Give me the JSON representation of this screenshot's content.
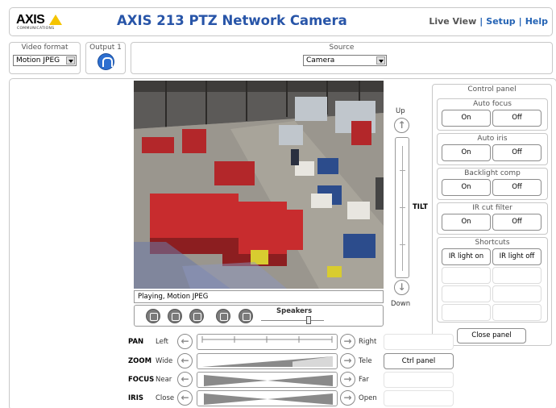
{
  "header": {
    "logo_text": "AXIS",
    "logo_subtext": "COMMUNICATIONS",
    "title": "AXIS 213 PTZ Network Camera",
    "nav": {
      "live_view": "Live View",
      "setup": "Setup",
      "help": "Help",
      "separator": "|"
    }
  },
  "toolbar": {
    "video_format": {
      "label": "Video format",
      "value": "Motion JPEG"
    },
    "output": {
      "label": "Output 1"
    },
    "source": {
      "label": "Source",
      "value": "Camera"
    }
  },
  "player": {
    "status": "Playing, Motion JPEG",
    "speakers_label": "Speakers",
    "volume": 0.75
  },
  "tilt": {
    "up_label": "Up",
    "down_label": "Down",
    "label": "TILT"
  },
  "control_panel": {
    "title": "Control panel",
    "auto_focus": {
      "title": "Auto focus",
      "on": "On",
      "off": "Off"
    },
    "auto_iris": {
      "title": "Auto iris",
      "on": "On",
      "off": "Off"
    },
    "backlight": {
      "title": "Backlight comp",
      "on": "On",
      "off": "Off"
    },
    "ir_cut": {
      "title": "IR cut filter",
      "on": "On",
      "off": "Off"
    },
    "shortcuts": {
      "title": "Shortcuts",
      "ir_on": "IR light on",
      "ir_off": "IR light off"
    },
    "close": "Close panel"
  },
  "ptz": {
    "pan": {
      "name": "PAN",
      "low": "Left",
      "high": "Right"
    },
    "zoom": {
      "name": "ZOOM",
      "low": "Wide",
      "high": "Tele"
    },
    "focus": {
      "name": "FOCUS",
      "low": "Near",
      "high": "Far"
    },
    "iris": {
      "name": "IRIS",
      "low": "Close",
      "high": "Open"
    },
    "ctrl_panel_button": "Ctrl panel"
  },
  "colors": {
    "title_blue": "#2855a8",
    "nav_blue": "#2463b4",
    "logo_yellow": "#f5c400",
    "output_blue": "#2d6fd0"
  }
}
